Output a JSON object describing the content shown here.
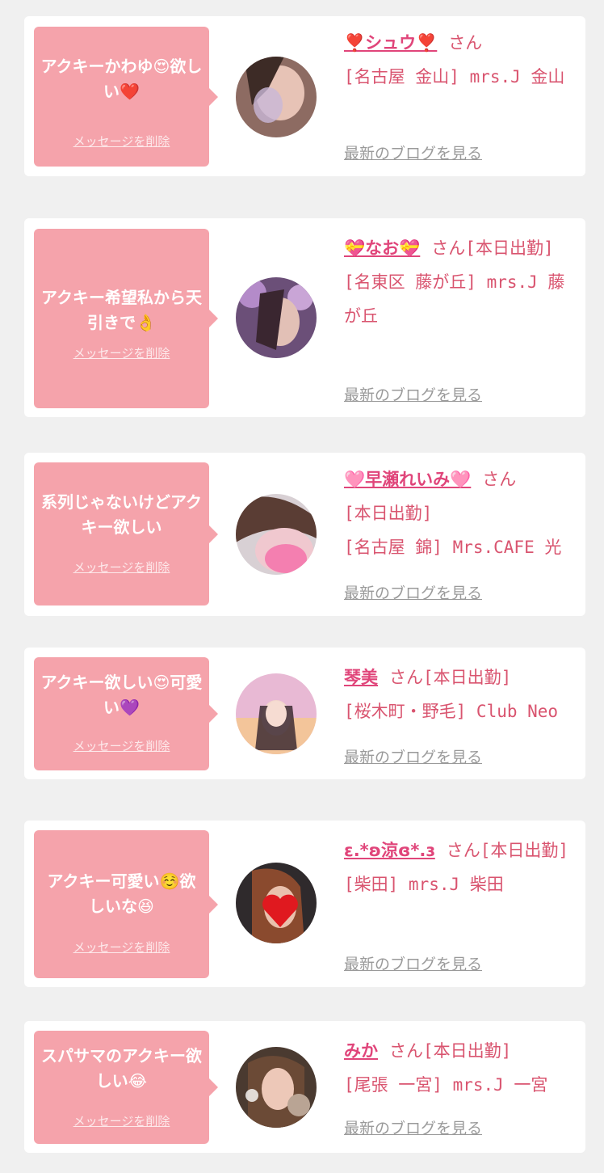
{
  "common": {
    "delete_label": "メッセージを削除",
    "blog_label": "最新のブログを見る",
    "san": "さん"
  },
  "colors": {
    "bubble": "#f5a3ab",
    "name": "#e0457a",
    "text": "#d9546f",
    "link_gray": "#9a9a9a",
    "background": "#f0f0f0"
  },
  "cards": [
    {
      "message": "アクキーかわゆ😍欲しい❤️",
      "name": "❣️シュウ❣️",
      "status": "",
      "shop": "[名古屋 金山] mrs.J 金山"
    },
    {
      "message": "アクキー希望私から天引きで👌",
      "name": "💝なお💝",
      "status": "[本日出勤]",
      "shop": "[名東区 藤が丘] mrs.J 藤が丘"
    },
    {
      "message": "系列じゃないけどアクキー欲しい",
      "name": "🩷早瀬れいみ🩷",
      "status": "[本日出勤]",
      "shop": "[名古屋 錦] Mrs.CAFE 光"
    },
    {
      "message": "アクキー欲しい😍可愛い💜",
      "name": "琴美",
      "status": "[本日出勤]",
      "shop": "[桜木町・野毛] Club Neo"
    },
    {
      "message": "アクキー可愛い☺️欲しいな😆",
      "name": "ε.*ʚ涼ɞ*.ɜ",
      "status": "[本日出勤]",
      "shop": "[柴田] mrs.J 柴田"
    },
    {
      "message": "スパサマのアクキー欲しい😂",
      "name": "みか",
      "status": "[本日出勤]",
      "shop": "[尾張 一宮] mrs.J 一宮"
    }
  ]
}
